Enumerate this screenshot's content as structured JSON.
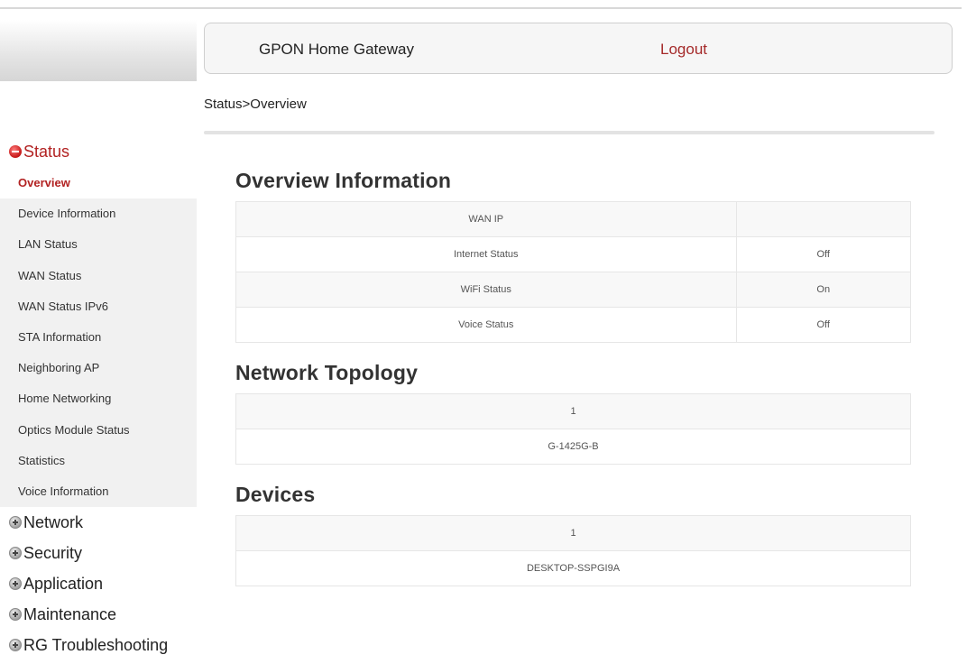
{
  "header": {
    "title": "GPON Home Gateway",
    "logout": "Logout"
  },
  "breadcrumb": "Status>Overview",
  "sidebar": {
    "status_label": "Status",
    "status_items": [
      {
        "label": "Overview",
        "active": true
      },
      {
        "label": "Device Information"
      },
      {
        "label": "LAN Status"
      },
      {
        "label": "WAN Status"
      },
      {
        "label": "WAN Status IPv6"
      },
      {
        "label": "STA Information"
      },
      {
        "label": "Neighboring AP"
      },
      {
        "label": "Home Networking"
      },
      {
        "label": "Optics Module Status"
      },
      {
        "label": "Statistics"
      },
      {
        "label": "Voice Information"
      }
    ],
    "menus": [
      {
        "label": "Network"
      },
      {
        "label": "Security"
      },
      {
        "label": "Application"
      },
      {
        "label": "Maintenance"
      },
      {
        "label": "RG Troubleshooting"
      }
    ]
  },
  "overview": {
    "title": "Overview Information",
    "rows": [
      {
        "label": "WAN IP",
        "value": ""
      },
      {
        "label": "Internet Status",
        "value": "Off"
      },
      {
        "label": "WiFi Status",
        "value": "On"
      },
      {
        "label": "Voice Status",
        "value": "Off"
      }
    ]
  },
  "topology": {
    "title": "Network Topology",
    "rows": [
      "1",
      "G-1425G-B"
    ]
  },
  "devices": {
    "title": "Devices",
    "rows": [
      "1",
      "DESKTOP-SSPGI9A"
    ]
  },
  "colors": {
    "accent": "#b22222",
    "logout": "#a52a2a"
  }
}
